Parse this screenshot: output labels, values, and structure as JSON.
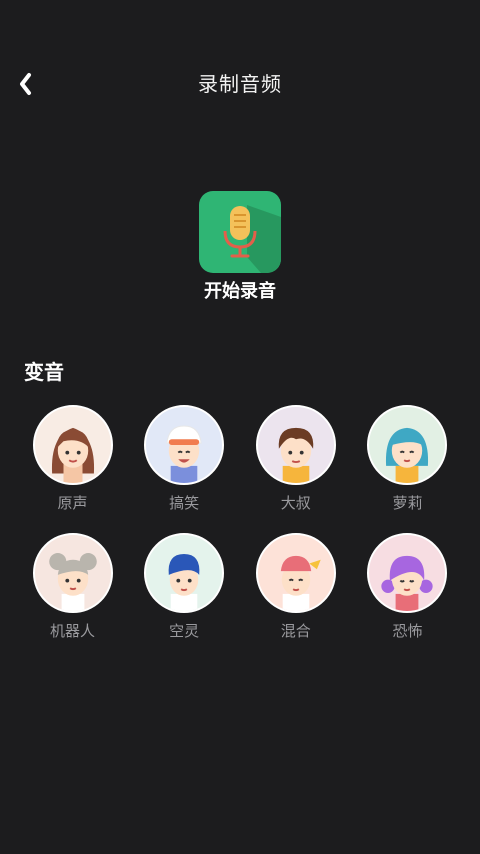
{
  "header": {
    "title": "录制音频",
    "back_icon": "chevron-left-icon"
  },
  "record": {
    "label": "开始录音",
    "icon": "microphone-icon",
    "colors": {
      "bg": "#2fb574",
      "mic": "#f4c15a"
    }
  },
  "voice_section": {
    "title": "变音",
    "items": [
      {
        "label": "原声",
        "bg": "#f8ece4",
        "hair": "#8a4b34"
      },
      {
        "label": "搞笑",
        "bg": "#e1e8f7",
        "hair": "#ffffff"
      },
      {
        "label": "大叔",
        "bg": "#ece4ee",
        "hair": "#6b3c24"
      },
      {
        "label": "萝莉",
        "bg": "#e2f0e4",
        "hair": "#3fa8c4"
      },
      {
        "label": "机器人",
        "bg": "#f6e6e0",
        "hair": "#b9b5ad"
      },
      {
        "label": "空灵",
        "bg": "#e4f3ec",
        "hair": "#2a57b8"
      },
      {
        "label": "混合",
        "bg": "#fde2d8",
        "hair": "#e86e78"
      },
      {
        "label": "恐怖",
        "bg": "#f7dde2",
        "hair": "#a766e0"
      }
    ]
  }
}
